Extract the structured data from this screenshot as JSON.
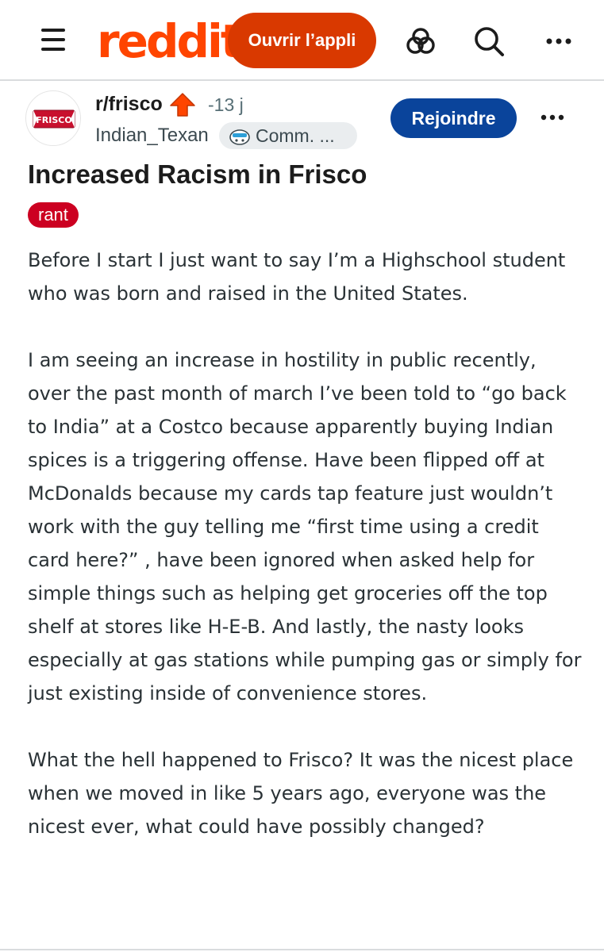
{
  "header": {
    "logo_text": "reddit",
    "open_app_label": "Ouvrir l’appli",
    "icons": [
      "menu-icon",
      "explore-icon",
      "search-icon",
      "more-icon"
    ]
  },
  "post": {
    "subreddit": "r/frisco",
    "subreddit_avatar_text": "FRISCO",
    "age": "-13 j",
    "author": "Indian_Texan",
    "user_flair": "Comm. ...",
    "join_label": "Rejoindre",
    "title": "Increased Racism in Frisco",
    "flair": "rant",
    "paragraphs": [
      "Before I start I just want to say I’m a Highschool student who was born and raised in the United States.",
      "I am seeing an increase in hostility in public recently, over the past month of march I’ve been told to “go back to India” at a Costco because apparently buying Indian spices is a triggering offense. Have been flipped off at McDonalds because my cards tap feature just wouldn’t work with the guy telling me “first time using a credit card here?” , have been ignored when asked help for simple things such as helping get groceries off the top shelf at stores like H-E-B. And lastly, the nasty looks especially at gas stations while pumping gas or simply for just existing inside of convenience stores.",
      "What the hell happened to Frisco? It was the nicest place when we moved in like 5 years ago, everyone was the nicest ever, what could have possibly changed?"
    ]
  },
  "colors": {
    "brand": "#ff4500",
    "open_app_bg": "#d93900",
    "join_bg": "#0a449b",
    "flair_bg": "#cc0021",
    "upvote": "#ff4500",
    "muted_text": "#576f76"
  }
}
